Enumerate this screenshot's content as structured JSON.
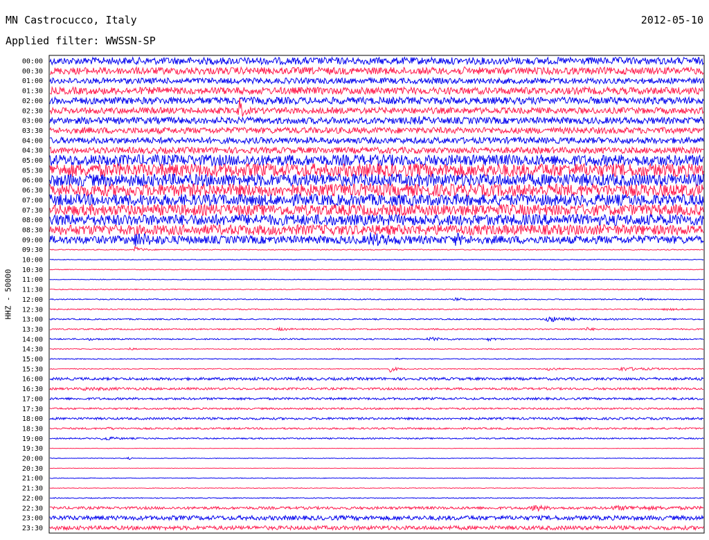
{
  "header": {
    "station": "MN Castrocucco, Italy",
    "date": "2012-05-10",
    "filter": "Applied filter: WWSSN-SP"
  },
  "chart_data": {
    "type": "line",
    "title": "MN Castrocucco, Italy",
    "date": "2012-05-10",
    "subtitle": "Applied filter: WWSSN-SP",
    "ylabel": "HHZ - 50000",
    "trace_colors": [
      "#0000ee",
      "#ff1a4d"
    ],
    "rows": [
      {
        "time": "00:00",
        "noise": 1.6
      },
      {
        "time": "00:30",
        "noise": 1.6,
        "events": [
          [
            0.62,
            0.6,
            0.01
          ]
        ]
      },
      {
        "time": "01:00",
        "noise": 1.3,
        "events": [
          [
            0.56,
            0.4,
            0.005
          ]
        ]
      },
      {
        "time": "01:30",
        "noise": 1.6
      },
      {
        "time": "02:00",
        "noise": 1.6
      },
      {
        "time": "02:30",
        "noise": 1.4,
        "events": [
          [
            0.29,
            5,
            0.004
          ]
        ]
      },
      {
        "time": "03:00",
        "noise": 1.5,
        "events": [
          [
            0.56,
            1.2,
            0.006
          ]
        ]
      },
      {
        "time": "03:30",
        "noise": 1.4
      },
      {
        "time": "04:00",
        "noise": 1.4
      },
      {
        "time": "04:30",
        "noise": 1.4
      },
      {
        "time": "05:00",
        "noise": 2.5
      },
      {
        "time": "05:30",
        "noise": 3
      },
      {
        "time": "06:00",
        "noise": 2.8
      },
      {
        "time": "06:30",
        "noise": 2.8
      },
      {
        "time": "07:00",
        "noise": 2.6
      },
      {
        "time": "07:30",
        "noise": 2.5
      },
      {
        "time": "08:00",
        "noise": 2.5
      },
      {
        "time": "08:30",
        "noise": 2.3
      },
      {
        "time": "09:00",
        "noise": 1.8,
        "events": [
          [
            0.13,
            2.2,
            0.02
          ],
          [
            0.49,
            2,
            0.02
          ],
          [
            0.62,
            1.8,
            0.01
          ]
        ]
      },
      {
        "time": "09:30",
        "noise": 0.2,
        "events": [
          [
            0.13,
            1.5,
            0.01
          ]
        ]
      },
      {
        "time": "10:00",
        "noise": 0.15
      },
      {
        "time": "10:30",
        "noise": 0.15
      },
      {
        "time": "11:00",
        "noise": 0.15
      },
      {
        "time": "11:30",
        "noise": 0.2
      },
      {
        "time": "12:00",
        "noise": 0.25,
        "events": [
          [
            0.62,
            0.5,
            0.02
          ],
          [
            0.9,
            0.6,
            0.01
          ]
        ]
      },
      {
        "time": "12:30",
        "noise": 0.25,
        "events": [
          [
            0.94,
            0.4,
            0.02
          ]
        ]
      },
      {
        "time": "13:00",
        "noise": 0.3,
        "events": [
          [
            0.76,
            1.2,
            0.03
          ]
        ]
      },
      {
        "time": "13:30",
        "noise": 0.3,
        "events": [
          [
            0.35,
            0.5,
            0.015
          ],
          [
            0.82,
            0.7,
            0.01
          ]
        ]
      },
      {
        "time": "14:00",
        "noise": 0.3,
        "events": [
          [
            0.06,
            0.35,
            0.01
          ],
          [
            0.58,
            0.7,
            0.02
          ],
          [
            0.67,
            0.6,
            0.01
          ]
        ]
      },
      {
        "time": "14:30",
        "noise": 0.2,
        "events": [
          [
            0.12,
            0.45,
            0.01
          ],
          [
            0.44,
            0.4,
            0.01
          ],
          [
            0.67,
            0.35,
            0.005
          ]
        ]
      },
      {
        "time": "15:00",
        "noise": 0.2,
        "events": [
          [
            0.53,
            0.4,
            0.005
          ]
        ]
      },
      {
        "time": "15:30",
        "noise": 0.2,
        "events": [
          [
            0.52,
            1.3,
            0.01
          ],
          [
            0.76,
            0.6,
            0.02
          ],
          [
            0.87,
            0.8,
            0.05
          ]
        ]
      },
      {
        "time": "16:00",
        "noise": 0.6,
        "events": [
          [
            0.31,
            0.4,
            0.008
          ],
          [
            0.38,
            0.3,
            0.005
          ]
        ]
      },
      {
        "time": "16:30",
        "noise": 0.5,
        "events": [
          [
            0.05,
            0.4,
            0.05
          ]
        ]
      },
      {
        "time": "17:00",
        "noise": 0.5
      },
      {
        "time": "17:30",
        "noise": 0.4
      },
      {
        "time": "18:00",
        "noise": 0.5
      },
      {
        "time": "18:30",
        "noise": 0.4,
        "events": [
          [
            0.09,
            0.5,
            0.005
          ]
        ]
      },
      {
        "time": "19:00",
        "noise": 0.3,
        "events": [
          [
            0.08,
            0.8,
            0.02
          ]
        ]
      },
      {
        "time": "19:30",
        "noise": 0.1
      },
      {
        "time": "20:00",
        "noise": 0.15,
        "events": [
          [
            0.12,
            0.5,
            0.004
          ]
        ]
      },
      {
        "time": "20:30",
        "noise": 0.1
      },
      {
        "time": "21:00",
        "noise": 0.15
      },
      {
        "time": "21:30",
        "noise": 0.15
      },
      {
        "time": "22:00",
        "noise": 0.2
      },
      {
        "time": "22:30",
        "noise": 0.6,
        "events": [
          [
            0.74,
            1.8,
            0.01
          ],
          [
            0.86,
            0.6,
            0.08
          ]
        ]
      },
      {
        "time": "23:00",
        "noise": 1.0
      },
      {
        "time": "23:30",
        "noise": 0.9
      }
    ]
  }
}
